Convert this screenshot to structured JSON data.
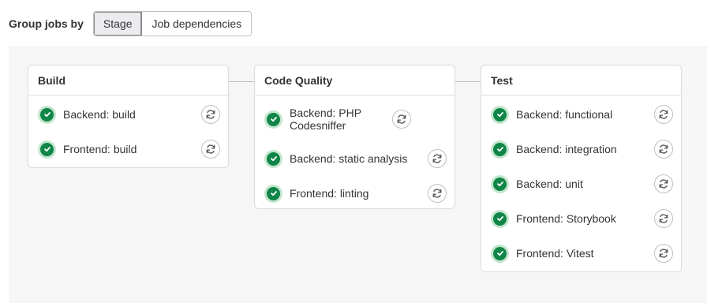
{
  "toolbar": {
    "group_label": "Group jobs by",
    "options": [
      "Stage",
      "Job dependencies"
    ],
    "selected": "Stage"
  },
  "stages": [
    {
      "title": "Build",
      "jobs": [
        {
          "name": "Backend: build",
          "status": "success"
        },
        {
          "name": "Frontend: build",
          "status": "success"
        }
      ]
    },
    {
      "title": "Code Quality",
      "jobs": [
        {
          "name": "Backend: PHP Codesniffer",
          "status": "success"
        },
        {
          "name": "Backend: static analysis",
          "status": "success"
        },
        {
          "name": "Frontend: linting",
          "status": "success"
        }
      ]
    },
    {
      "title": "Test",
      "jobs": [
        {
          "name": "Backend: functional",
          "status": "success"
        },
        {
          "name": "Backend: integration",
          "status": "success"
        },
        {
          "name": "Backend: unit",
          "status": "success"
        },
        {
          "name": "Frontend: Storybook",
          "status": "success"
        },
        {
          "name": "Frontend: Vitest",
          "status": "success"
        }
      ]
    }
  ],
  "icons": {
    "status": "check-circle-icon",
    "retry": "retry-icon"
  },
  "colors": {
    "success": "#108548",
    "success_ring": "#c3e6cd"
  }
}
